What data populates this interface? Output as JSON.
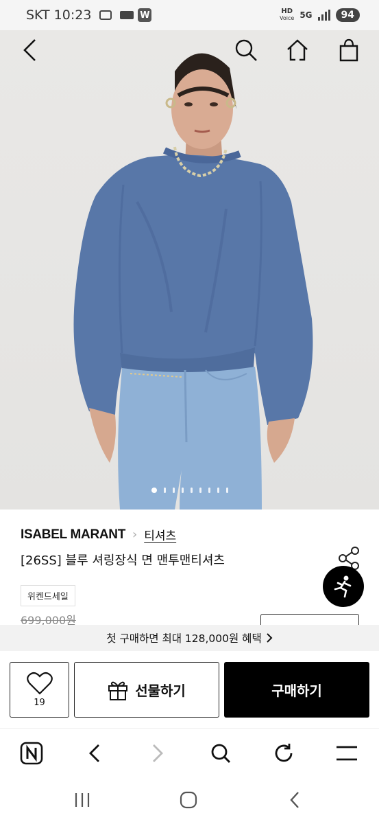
{
  "status_bar": {
    "carrier": "SKT",
    "time": "10:23",
    "app_badge": "W",
    "hd_voice_top": "HD",
    "hd_voice_bottom": "Voice",
    "network": "5G",
    "battery": "94"
  },
  "top_nav": {
    "back_icon": "chevron-left-icon",
    "search_icon": "search-icon",
    "home_icon": "home-icon",
    "cart_icon": "shopping-bag-icon"
  },
  "gallery": {
    "total_images": 9,
    "active_index": 0
  },
  "product": {
    "brand": "ISABEL MARANT",
    "category": "티셔츠",
    "title": "[26SS] 블루 셔링장식 면 맨투맨티셔츠",
    "tag": "위켄드세일",
    "original_price": "699,000원"
  },
  "benefit_banner": {
    "text": "첫 구매하면 최대 128,000원 혜택"
  },
  "actions": {
    "like_count": "19",
    "gift_label": "선물하기",
    "buy_label": "구매하기"
  },
  "colors": {
    "sweatshirt": "#5877a8",
    "jeans": "#8fb1d6",
    "buy_button": "#000000",
    "banner_bg": "#f2f2f2"
  }
}
